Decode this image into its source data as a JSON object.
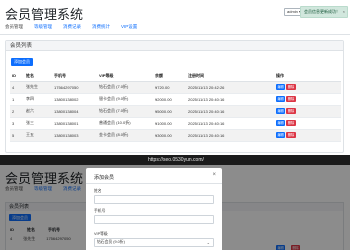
{
  "app": {
    "title": "会员管理系统",
    "nav": [
      "会员管理",
      "等级管理",
      "消费记录",
      "消费统计",
      "VIP设置"
    ],
    "admin_label": "admin ▾",
    "toast_text": "会员信息更新成功！",
    "toast_close": "×"
  },
  "members": {
    "card_title": "会员列表",
    "add_button": "添加会员",
    "columns": [
      "ID",
      "姓名",
      "手机号",
      "VIP等级",
      "余额",
      "注册时间",
      "操作"
    ],
    "rows": [
      {
        "id": "4",
        "name": "张先生",
        "phone": "17564297050",
        "level": "钻石会员 (7.0折)",
        "balance": "¥720.00",
        "time": "2025/11/13 20:42:26"
      },
      {
        "id": "1",
        "name": "李四",
        "phone": "13800138002",
        "level": "银卡会员 (9.0折)",
        "balance": "¥2000.00",
        "time": "2025/11/13 20:40:16"
      },
      {
        "id": "2",
        "name": "赵六",
        "phone": "13800138004",
        "level": "钻石会员 (7.0折)",
        "balance": "¥5000.00",
        "time": "2025/11/13 20:40:16"
      },
      {
        "id": "3",
        "name": "张三",
        "phone": "13800138001",
        "level": "普通会员 (10.0折)",
        "balance": "¥1000.00",
        "time": "2025/11/13 20:40:16"
      },
      {
        "id": "5",
        "name": "王五",
        "phone": "13800138003",
        "level": "金卡会员 (8.0折)",
        "balance": "¥3000.00",
        "time": "2025/11/13 20:40:16"
      }
    ],
    "edit_label": "编辑",
    "delete_label": "删除"
  },
  "watermark": "https://seo.0530yun.com/",
  "bottom": {
    "title": "会员管理系统",
    "nav": [
      "会员管理",
      "等级管理",
      "消费记录",
      "消费统计",
      "VIP设置"
    ],
    "card_title": "会员列表",
    "add_button": "添加会员",
    "columns": [
      "ID",
      "姓名",
      "手机号"
    ],
    "row": {
      "id": "4",
      "name": "张先生",
      "phone": "17564297050"
    },
    "modal": {
      "title": "添加会员",
      "close": "×",
      "name_label": "姓名",
      "phone_label": "手机号",
      "level_label": "VIP等级",
      "level_value": "钻石会员 (9.0折)"
    }
  },
  "colors": {
    "primary": "#0d6efd",
    "danger": "#dc3545",
    "success_bg": "#d1e7dd"
  }
}
